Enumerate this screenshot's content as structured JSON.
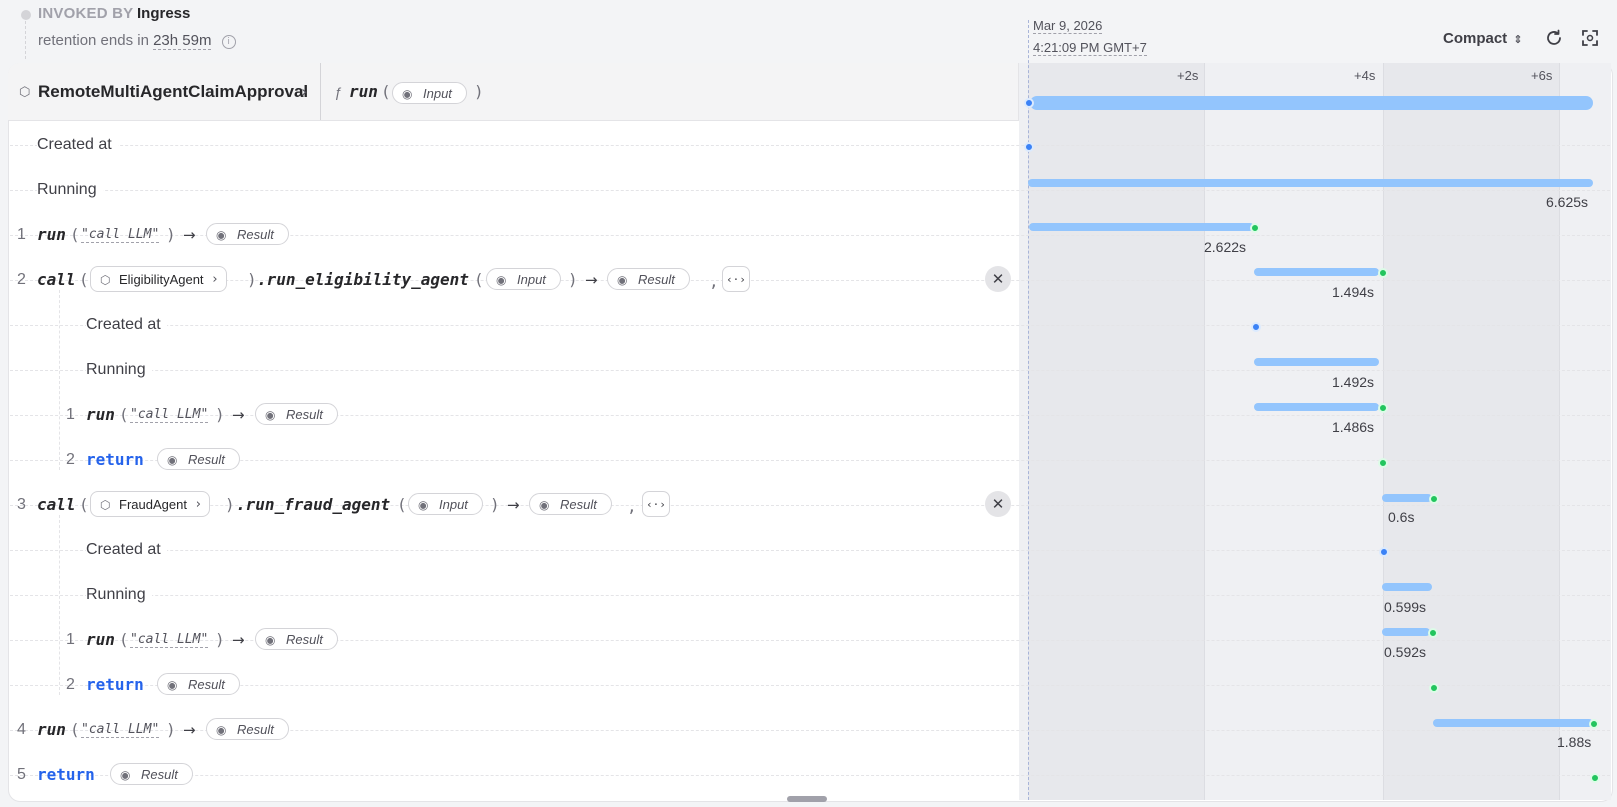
{
  "header": {
    "invoked_by_label": "INVOKED BY",
    "invoked_by_value": "Ingress",
    "retention_prefix": "retention ends in",
    "retention_value": "23h 59m",
    "date": "Mar 9, 2026",
    "time": "4:21:09 PM GMT+7",
    "view_mode": "Compact"
  },
  "invocation": {
    "service": "RemoteMultiAgentClaimApproval",
    "handler": "run",
    "input_label": "Input"
  },
  "timeline": {
    "ticks": [
      "+2s",
      "+4s",
      "+6s"
    ]
  },
  "rows": {
    "created_at": "Created at",
    "running": "Running",
    "running_duration": "6.625s",
    "step1": {
      "num": "1",
      "fn": "run",
      "arg": "\"call LLM\"",
      "result": "Result",
      "duration": "2.622s"
    },
    "step2": {
      "num": "2",
      "fn": "call",
      "service": "EligibilityAgent",
      "method": ".run_eligibility_agent",
      "input": "Input",
      "result": "Result",
      "duration": "1.494s",
      "created_at": "Created at",
      "running": "Running",
      "running_duration": "1.492s",
      "sub1": {
        "num": "1",
        "fn": "run",
        "arg": "\"call LLM\"",
        "result": "Result",
        "duration": "1.486s"
      },
      "sub2": {
        "num": "2",
        "fn": "return",
        "result": "Result"
      }
    },
    "step3": {
      "num": "3",
      "fn": "call",
      "service": "FraudAgent",
      "method": ".run_fraud_agent",
      "input": "Input",
      "result": "Result",
      "duration": "0.6s",
      "created_at": "Created at",
      "running": "Running",
      "running_duration": "0.599s",
      "sub1": {
        "num": "1",
        "fn": "run",
        "arg": "\"call LLM\"",
        "result": "Result",
        "duration": "0.592s"
      },
      "sub2": {
        "num": "2",
        "fn": "return",
        "result": "Result"
      }
    },
    "step4": {
      "num": "4",
      "fn": "run",
      "arg": "\"call LLM\"",
      "result": "Result",
      "duration": "1.88s"
    },
    "step5": {
      "num": "5",
      "fn": "return",
      "result": "Result"
    }
  },
  "icons": {
    "eye": "eye-icon",
    "cube": "cube-icon",
    "refresh": "refresh-icon",
    "fit": "fit-to-screen-icon",
    "close": "close-icon",
    "code": "code-icon",
    "info": "info-icon"
  }
}
